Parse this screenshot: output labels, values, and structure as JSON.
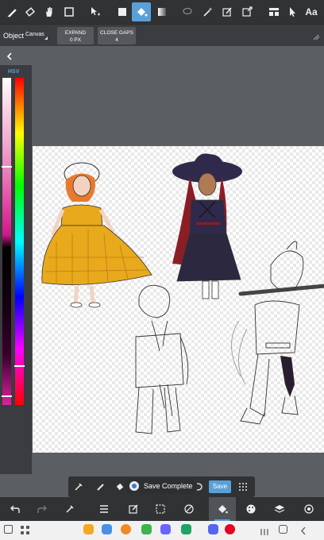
{
  "option_bar": {
    "object_label": "Object",
    "object_value": "Canvas",
    "expand_title": "EXPAND",
    "expand_value": "0 PX",
    "close_gaps_title": "CLOSE GAPS",
    "close_gaps_value": "4"
  },
  "toolbar": {
    "text_tool_label": "Aa"
  },
  "color_panel": {
    "mode_label": "HSV"
  },
  "toast": {
    "message": "Save Complete"
  },
  "bottom_tools": {
    "save_label": "Save"
  },
  "colors": {
    "accent": "#5aa0d8",
    "toolbar_bg": "#303234",
    "paint_yellow": "#e8a91c",
    "navy": "#2f2a4b"
  }
}
